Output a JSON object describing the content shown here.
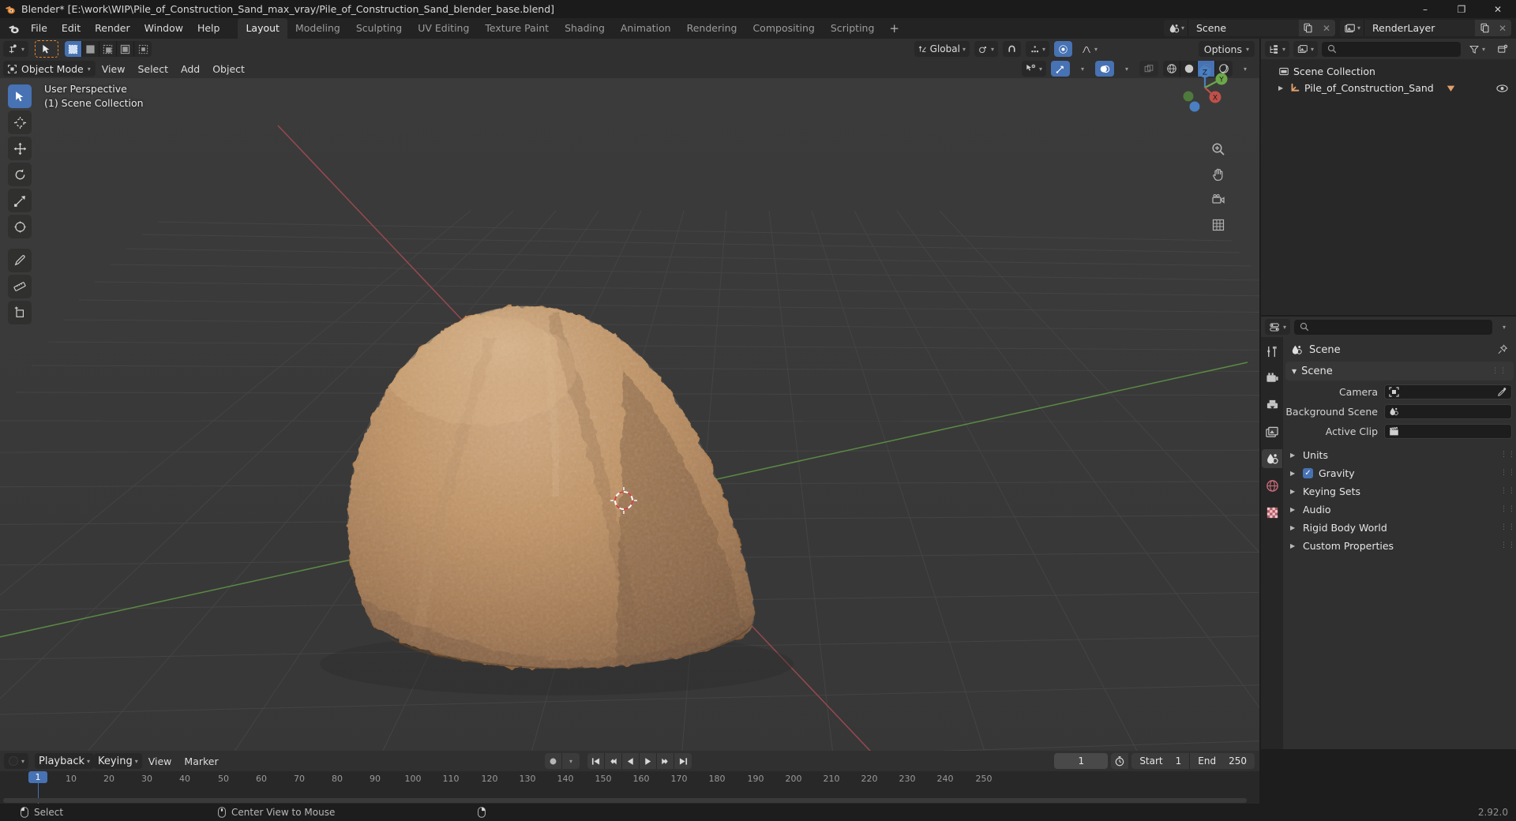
{
  "window": {
    "title": "Blender* [E:\\work\\WIP\\Pile_of_Construction_Sand_max_vray/Pile_of_Construction_Sand_blender_base.blend]",
    "minimize": "–",
    "maximize": "❐",
    "close": "✕"
  },
  "menu": {
    "items": [
      "File",
      "Edit",
      "Render",
      "Window",
      "Help"
    ]
  },
  "workspaces": {
    "tabs": [
      "Layout",
      "Modeling",
      "Sculpting",
      "UV Editing",
      "Texture Paint",
      "Shading",
      "Animation",
      "Rendering",
      "Compositing",
      "Scripting"
    ],
    "active": "Layout",
    "add_label": "+"
  },
  "topbar_right": {
    "scene": {
      "name": "Scene",
      "new_icon": "copy-icon",
      "unlink_icon": "x-icon"
    },
    "view_layer": {
      "name": "RenderLayer",
      "new_icon": "copy-icon",
      "unlink_icon": "x-icon"
    }
  },
  "viewport": {
    "tool_dropdown_icon": "transform-pivot-icon",
    "select_tool_icon": "tweak-cursor-icon",
    "select_modes": [
      "set",
      "extend",
      "subtract",
      "invert",
      "intersect"
    ],
    "mode": "Object Mode",
    "menus": [
      "View",
      "Select",
      "Add",
      "Object"
    ],
    "transform_orientation": "Global",
    "pivot_icon": "pivot-point-icon",
    "snap_icon": "magnet-icon",
    "proportional_icon": "proportional-edit-icon",
    "options_label": "Options",
    "overlay_line1": "User Perspective",
    "overlay_line2": "(1) Scene Collection",
    "shading_modes": [
      "Wireframe",
      "Solid",
      "Material Preview",
      "Rendered"
    ],
    "active_shading": "Material Preview",
    "gizmo_axes": {
      "z": "Z",
      "y": "Y",
      "x": "X"
    },
    "tools": [
      "tweak-select-tool",
      "cursor-tool",
      "move-tool",
      "rotate-tool",
      "scale-tool",
      "transform-tool",
      "annotate-tool",
      "measure-tool",
      "add-cube-tool"
    ],
    "nav_buttons": [
      "zoom-icon",
      "pan-hand-icon",
      "camera-view-icon",
      "toggle-ortho-icon"
    ]
  },
  "outliner": {
    "display_mode_icon": "outliner-view-layer-icon",
    "filter_icon": "filter-funnel-icon",
    "new_collection_icon": "new-collection-icon",
    "search_placeholder": "",
    "rows": [
      {
        "label": "Scene Collection",
        "icon": "scene-collection-icon",
        "indent": 0,
        "expander": "",
        "selected": false
      },
      {
        "label": "Pile_of_Construction_Sand",
        "icon": "mesh-object-icon",
        "indent": 1,
        "expander": "▶",
        "selected": false,
        "modifier_icon": "modifier-triangle-icon",
        "eye_icon": "eye-icon"
      }
    ]
  },
  "properties": {
    "editor_icon": "properties-editor-icon",
    "search_placeholder": "",
    "tabs": [
      {
        "name": "tool",
        "icon": "tool-wrench-icon",
        "active": false
      },
      {
        "name": "render",
        "icon": "render-camera-icon",
        "active": false
      },
      {
        "name": "output",
        "icon": "output-printer-icon",
        "active": false
      },
      {
        "name": "view-layer",
        "icon": "view-layer-images-icon",
        "active": false
      },
      {
        "name": "scene",
        "icon": "scene-droplet-icon",
        "active": true
      },
      {
        "name": "world",
        "icon": "world-globe-icon",
        "active": false
      },
      {
        "name": "texture",
        "icon": "texture-checker-icon",
        "active": false
      }
    ],
    "breadcrumb": "Scene",
    "pin_icon": "pin-icon",
    "panel_scene": {
      "title": "Scene",
      "expanded": true,
      "rows": [
        {
          "label": "Camera",
          "value": "",
          "icon": "camera-data-icon",
          "eyedropper": true
        },
        {
          "label": "Background Scene",
          "value": "",
          "icon": "scene-droplet-icon",
          "eyedropper": false
        },
        {
          "label": "Active Clip",
          "value": "",
          "icon": "movie-clip-icon",
          "eyedropper": false
        }
      ]
    },
    "sub_panels": [
      {
        "label": "Units",
        "checkbox": null
      },
      {
        "label": "Gravity",
        "checkbox": true
      },
      {
        "label": "Keying Sets",
        "checkbox": null
      },
      {
        "label": "Audio",
        "checkbox": null
      },
      {
        "label": "Rigid Body World",
        "checkbox": null
      },
      {
        "label": "Custom Properties",
        "checkbox": null
      }
    ]
  },
  "timeline": {
    "editor_icon": "timeline-editor-icon",
    "menus": [
      "Playback",
      "Keying",
      "View",
      "Marker"
    ],
    "record_icon": "record-keyframes-icon",
    "transport": [
      "jump-to-start-icon",
      "prev-keyframe-icon",
      "play-reverse-icon",
      "play-icon",
      "next-keyframe-icon",
      "jump-to-end-icon"
    ],
    "current_frame": "1",
    "frame_autokey_icon": "stopwatch-icon",
    "start_label": "Start",
    "start_value": "1",
    "end_label": "End",
    "end_value": "250",
    "ticks": [
      "1",
      "10",
      "20",
      "30",
      "40",
      "50",
      "60",
      "70",
      "80",
      "90",
      "100",
      "110",
      "120",
      "130",
      "140",
      "150",
      "160",
      "170",
      "180",
      "190",
      "200",
      "210",
      "220",
      "230",
      "240",
      "250"
    ],
    "playhead_frame": "1"
  },
  "statusbar": {
    "items": [
      {
        "icon": "mouse-left-icon",
        "label": "Select"
      },
      {
        "icon": "mouse-middle-icon",
        "label": "Center View to Mouse"
      },
      {
        "icon": "mouse-right-icon",
        "label": ""
      }
    ],
    "version": "2.92.0"
  },
  "colors": {
    "accent": "#4772b3",
    "bg_dark": "#1d1d1d",
    "bg_panel": "#303030",
    "bg_outliner": "#282828",
    "viewport_bg": "#393939",
    "grid": "#4a4a4a",
    "axis_x": "#9c4b53",
    "axis_y": "#5a8f42",
    "sand_light": "#c79a6e",
    "sand_mid": "#a8794f",
    "sand_dark": "#6f4e33",
    "text": "#e5e5e5",
    "orange": "#e8852a"
  }
}
